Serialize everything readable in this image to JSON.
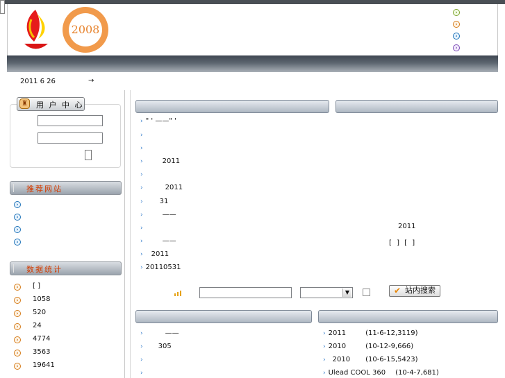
{
  "user_center": {
    "title": "用 户 中 心"
  },
  "date_bar": {
    "date": "2011 6 26",
    "arrow": "→"
  },
  "recommend": {
    "title": "推荐网站"
  },
  "stats": {
    "title": "数据统计",
    "values": [
      "[ ]",
      "1058",
      "520",
      "24",
      "4774",
      "3563",
      "19641"
    ]
  },
  "news": {
    "rows": [
      "\" ' ——\" '",
      "",
      "",
      "2011",
      "",
      "2011",
      "31",
      "——",
      "",
      "——",
      "2011",
      "20110531"
    ],
    "side_texts": [
      "2011",
      "[  ]  [  ]"
    ]
  },
  "search": {
    "button_label": "站内搜索",
    "icon": "signal-icon"
  },
  "bottom_left": {
    "rows": [
      "——",
      "305",
      "",
      ""
    ]
  },
  "bottom_right": {
    "rows": [
      {
        "name": "2011",
        "meta": "(11-6-12,3119)"
      },
      {
        "name": "2010",
        "meta": "(10-12-9,666)"
      },
      {
        "name": "2010",
        "meta": "(10-6-15,5423)"
      },
      {
        "name": "Ulead COOL 360",
        "meta": "(10-4-7,681)"
      }
    ]
  },
  "colors": {
    "orange_logo": "#e8782e",
    "red_logo": "#d92020",
    "accent": "#d23b00"
  }
}
